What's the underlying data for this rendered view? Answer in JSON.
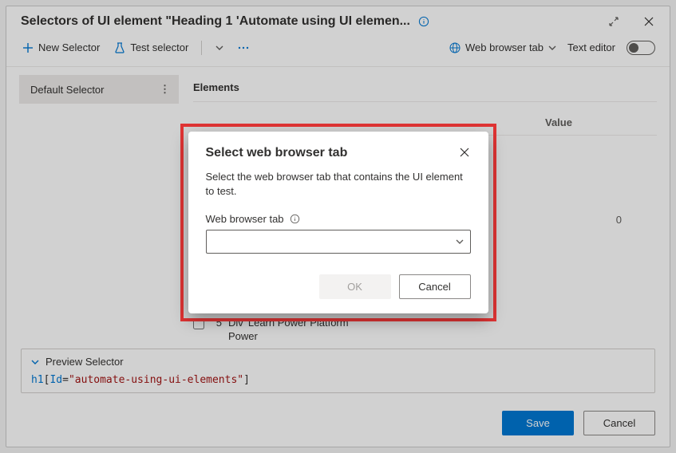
{
  "title": "Selectors of UI element \"Heading 1 'Automate using UI elemen...",
  "toolbar": {
    "new_selector": "New Selector",
    "test_selector": "Test selector",
    "web_tab": "Web browser tab",
    "text_editor": "Text editor"
  },
  "sidebar": {
    "items": [
      {
        "label": "Default Selector"
      }
    ]
  },
  "content": {
    "elements_heading": "Elements",
    "value_heading": "Value",
    "peek_row": {
      "index": "5",
      "text": "Div 'Learn Power Platform Power"
    },
    "value_sample": "0"
  },
  "preview": {
    "toggle_label": "Preview Selector",
    "tag": "h1",
    "attr_name": "Id",
    "attr_value": "\"automate-using-ui-elements\""
  },
  "footer": {
    "save": "Save",
    "cancel": "Cancel"
  },
  "modal": {
    "title": "Select web browser tab",
    "description": "Select the web browser tab that contains the UI element to test.",
    "field_label": "Web browser tab",
    "ok": "OK",
    "cancel": "Cancel"
  }
}
